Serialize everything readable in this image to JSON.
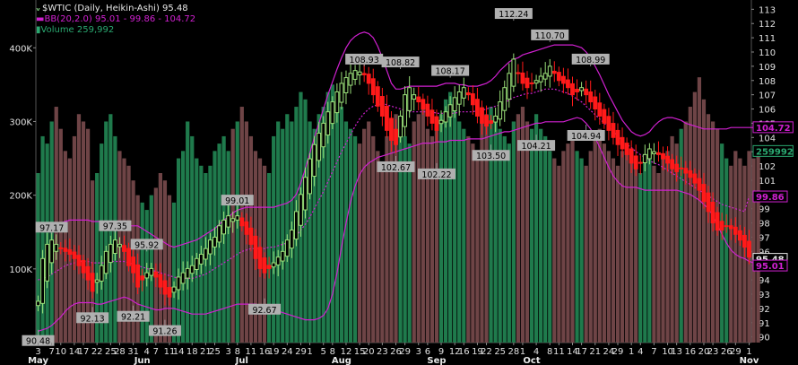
{
  "legend": {
    "title": "$WTIC (Daily, Heikin-Ashi) 95.48",
    "bb": "BB(20,2.0) 95.01 - 99.86 - 104.72",
    "volume": "Volume 259,992"
  },
  "chart_data": {
    "type": "candlestick",
    "title": "$WTIC (Daily, Heikin-Ashi) 95.48",
    "price_axis": {
      "ylim": [
        89.6,
        113.4
      ],
      "ticks": [
        90,
        91,
        92,
        93,
        94,
        95,
        96,
        97,
        98,
        99,
        100,
        101,
        102,
        103,
        104,
        105,
        106,
        107,
        108,
        109,
        110,
        111,
        112,
        113
      ]
    },
    "volume_axis": {
      "ylim": [
        0,
        460000
      ],
      "ticks": [
        "100K",
        "200K",
        "300K",
        "400K"
      ],
      "tick_values": [
        100000,
        200000,
        300000,
        400000
      ]
    },
    "x_tick_labels": [
      "3",
      "7",
      "10",
      "14",
      "17",
      "22",
      "25",
      "28",
      "31",
      "4",
      "7",
      "11",
      "14",
      "18",
      "21",
      "25",
      "3",
      "8",
      "11",
      "16",
      "19",
      "24",
      "29",
      "1",
      "5",
      "8",
      "12",
      "15",
      "20",
      "23",
      "26",
      "29",
      "3",
      "6",
      "9",
      "12",
      "16",
      "19",
      "22",
      "25",
      "28",
      "1",
      "4",
      "8",
      "11",
      "14",
      "17",
      "21",
      "24",
      "29",
      "1",
      "4",
      "7",
      "10",
      "13",
      "16",
      "20",
      "23",
      "26",
      "29",
      "1"
    ],
    "x_month_labels": [
      "May",
      "Jun",
      "Jul",
      "Aug",
      "Sep",
      "Oct",
      "Nov"
    ],
    "month_label_indices": [
      0,
      23,
      45,
      67,
      88,
      109,
      130
    ],
    "price_labels": [
      {
        "text": "97.17",
        "i": 3,
        "price": 97.2
      },
      {
        "text": "97.35",
        "i": 17,
        "price": 97.3
      },
      {
        "text": "95.92",
        "i": 24,
        "price": 96.0
      },
      {
        "text": "99.01",
        "i": 44,
        "price": 99.1
      },
      {
        "text": "108.93",
        "i": 72,
        "price": 109.0
      },
      {
        "text": "108.82",
        "i": 80,
        "price": 108.8
      },
      {
        "text": "108.17",
        "i": 91,
        "price": 108.2
      },
      {
        "text": "112.24",
        "i": 105,
        "price": 112.2
      },
      {
        "text": "110.70",
        "i": 113,
        "price": 110.7
      },
      {
        "text": "108.99",
        "i": 122,
        "price": 109.0
      },
      {
        "text": "90.48",
        "i": 0,
        "price": 90.5
      },
      {
        "text": "92.13",
        "i": 12,
        "price": 92.1
      },
      {
        "text": "92.21",
        "i": 21,
        "price": 92.2
      },
      {
        "text": "91.26",
        "i": 28,
        "price": 91.2
      },
      {
        "text": "92.67",
        "i": 50,
        "price": 92.7
      },
      {
        "text": "102.67",
        "i": 79,
        "price": 102.7
      },
      {
        "text": "102.22",
        "i": 88,
        "price": 102.2
      },
      {
        "text": "103.50",
        "i": 100,
        "price": 103.5
      },
      {
        "text": "104.21",
        "i": 110,
        "price": 104.2
      },
      {
        "text": "104.94",
        "i": 121,
        "price": 104.9
      }
    ],
    "last_labels": [
      {
        "text": "104.72",
        "price": 104.72,
        "color": "#d020d0"
      },
      {
        "text": "99.86",
        "price": 99.86,
        "color": "#d020d0"
      },
      {
        "text": "95.48",
        "price": 95.48,
        "color": "#e8e8e8"
      },
      {
        "text": "95.01",
        "price": 95.01,
        "color": "#d020d0"
      },
      {
        "text": "259992",
        "vol": 259992,
        "color": "#2aa870"
      }
    ],
    "close_path": [
      92.5,
      95.5,
      96.5,
      96.8,
      96.5,
      96.2,
      96.0,
      95.8,
      95.5,
      95.0,
      94.5,
      94.0,
      93.2,
      94.0,
      95.0,
      96.0,
      96.5,
      96.8,
      96.5,
      96.0,
      95.0,
      94.5,
      93.5,
      94.0,
      94.5,
      94.8,
      94.2,
      93.5,
      93.0,
      92.8,
      93.5,
      94.2,
      94.5,
      94.8,
      95.0,
      95.5,
      95.8,
      96.2,
      96.8,
      97.0,
      97.8,
      98.2,
      98.5,
      98.3,
      98.5,
      97.8,
      97.2,
      96.5,
      95.5,
      94.8,
      94.5,
      94.8,
      95.2,
      95.6,
      96.0,
      96.8,
      97.5,
      98.8,
      100.0,
      101.2,
      102.5,
      103.5,
      104.3,
      105.0,
      105.8,
      106.5,
      107.2,
      107.8,
      108.2,
      108.5,
      108.7,
      108.6,
      108.4,
      107.8,
      107.0,
      106.2,
      105.5,
      104.5,
      103.8,
      103.5,
      105.5,
      107.0,
      107.5,
      107.0,
      106.5,
      106.0,
      105.5,
      105.0,
      104.5,
      105.2,
      105.8,
      106.3,
      106.8,
      107.2,
      107.5,
      107.0,
      106.3,
      105.5,
      105.0,
      104.8,
      105.0,
      105.5,
      106.5,
      107.5,
      108.5,
      109.5,
      108.5,
      107.8,
      107.5,
      107.8,
      108.0,
      108.3,
      108.5,
      109.0,
      108.5,
      108.0,
      107.8,
      107.5,
      107.0,
      107.2,
      107.5,
      107.0,
      106.5,
      106.0,
      105.5,
      105.0,
      104.5,
      104.0,
      103.5,
      103.2,
      102.8,
      102.2,
      101.8,
      102.2,
      102.8,
      103.2,
      103.0,
      102.8,
      102.5,
      102.2,
      101.8,
      101.6,
      101.8,
      101.5,
      101.2,
      100.8,
      100.3,
      99.5,
      98.8,
      98.0,
      97.5,
      97.5,
      97.8,
      97.6,
      97.2,
      96.8,
      96.3,
      95.6
    ],
    "volume": [
      230,
      280,
      270,
      300,
      320,
      290,
      260,
      250,
      280,
      310,
      300,
      290,
      220,
      230,
      270,
      300,
      310,
      280,
      260,
      250,
      240,
      220,
      200,
      190,
      180,
      200,
      210,
      230,
      220,
      200,
      190,
      250,
      260,
      300,
      280,
      250,
      240,
      230,
      240,
      260,
      270,
      280,
      260,
      290,
      300,
      320,
      300,
      280,
      260,
      250,
      240,
      230,
      280,
      300,
      290,
      310,
      300,
      320,
      340,
      330,
      300,
      290,
      310,
      320,
      340,
      350,
      330,
      320,
      300,
      290,
      280,
      270,
      290,
      300,
      280,
      260,
      240,
      280,
      300,
      310,
      290,
      280,
      270,
      300,
      310,
      320,
      290,
      280,
      300,
      310,
      330,
      340,
      320,
      300,
      290,
      280,
      270,
      260,
      300,
      310,
      320,
      300,
      290,
      280,
      270,
      300,
      310,
      320,
      300,
      290,
      310,
      290,
      280,
      260,
      250,
      240,
      260,
      270,
      280,
      260,
      250,
      240,
      260,
      280,
      290,
      270,
      260,
      250,
      240,
      260,
      270,
      250,
      240,
      230,
      250,
      260,
      240,
      230,
      250,
      260,
      280,
      270,
      290,
      300,
      320,
      340,
      360,
      330,
      310,
      300,
      290,
      270,
      250,
      240,
      260,
      250,
      240,
      260,
      250,
      260
    ],
    "bb_upper": [
      97.6,
      97.8,
      97.9,
      98.0,
      98.0,
      98.0,
      98.1,
      98.2,
      98.2,
      98.2,
      98.2,
      98.2,
      98.1,
      98.1,
      98.1,
      98.0,
      98.0,
      97.9,
      97.8,
      97.8,
      97.8,
      97.8,
      97.8,
      97.6,
      97.4,
      97.2,
      97.0,
      96.8,
      96.6,
      96.4,
      96.3,
      96.4,
      96.5,
      96.6,
      96.7,
      96.8,
      97.0,
      97.2,
      97.4,
      97.6,
      97.9,
      98.2,
      98.4,
      98.7,
      98.9,
      99.0,
      99.1,
      99.1,
      99.1,
      99.1,
      99.1,
      99.1,
      99.1,
      99.2,
      99.3,
      99.4,
      99.6,
      100.0,
      100.8,
      101.8,
      102.9,
      104.0,
      105.0,
      106.0,
      107.0,
      107.9,
      108.8,
      109.6,
      110.3,
      110.8,
      111.1,
      111.3,
      111.4,
      111.3,
      111.0,
      110.4,
      109.6,
      108.7,
      107.8,
      107.4,
      107.4,
      107.5,
      107.6,
      107.6,
      107.6,
      107.6,
      107.6,
      107.6,
      107.6,
      107.7,
      107.8,
      107.8,
      107.8,
      107.7,
      107.7,
      107.6,
      107.6,
      107.6,
      107.7,
      107.8,
      108.0,
      108.3,
      108.7,
      109.0,
      109.3,
      109.5,
      109.6,
      109.8,
      109.9,
      110.0,
      110.1,
      110.2,
      110.3,
      110.4,
      110.5,
      110.5,
      110.5,
      110.5,
      110.5,
      110.4,
      110.3,
      110.0,
      109.6,
      109.0,
      108.4,
      107.7,
      107.0,
      106.4,
      105.8,
      105.2,
      104.8,
      104.4,
      104.2,
      104.1,
      104.2,
      104.4,
      104.8,
      105.1,
      105.3,
      105.4,
      105.4,
      105.3,
      105.2,
      105.0,
      104.9,
      104.8,
      104.7,
      104.6,
      104.6,
      104.6,
      104.6,
      104.6,
      104.6,
      104.7,
      104.7,
      104.7,
      104.7,
      104.7,
      104.7,
      104.72
    ],
    "bb_mid": [
      94.0,
      94.1,
      94.2,
      94.4,
      94.6,
      94.8,
      95.0,
      95.1,
      95.2,
      95.3,
      95.3,
      95.3,
      95.2,
      95.2,
      95.2,
      95.2,
      95.3,
      95.3,
      95.3,
      95.3,
      95.2,
      95.1,
      95.0,
      94.9,
      94.8,
      94.7,
      94.6,
      94.5,
      94.4,
      94.3,
      94.2,
      94.1,
      94.1,
      94.1,
      94.1,
      94.2,
      94.3,
      94.4,
      94.6,
      94.8,
      95.0,
      95.2,
      95.4,
      95.6,
      95.8,
      96.0,
      96.1,
      96.2,
      96.2,
      96.2,
      96.2,
      96.3,
      96.3,
      96.4,
      96.5,
      96.6,
      96.8,
      97.1,
      97.5,
      97.9,
      98.4,
      99.0,
      99.6,
      100.2,
      100.9,
      101.6,
      102.3,
      103.0,
      103.6,
      104.2,
      104.8,
      105.3,
      105.7,
      106.0,
      106.2,
      106.3,
      106.4,
      106.3,
      106.2,
      106.1,
      106.0,
      105.9,
      105.8,
      105.8,
      105.8,
      105.8,
      105.8,
      105.8,
      105.7,
      105.7,
      105.7,
      105.7,
      105.7,
      105.8,
      105.8,
      105.8,
      105.8,
      105.9,
      105.9,
      106.0,
      106.1,
      106.2,
      106.3,
      106.5,
      106.6,
      106.8,
      106.9,
      107.0,
      107.1,
      107.1,
      107.2,
      107.3,
      107.4,
      107.4,
      107.4,
      107.3,
      107.2,
      107.1,
      106.9,
      106.7,
      106.5,
      106.2,
      105.9,
      105.6,
      105.3,
      105.0,
      104.7,
      104.4,
      104.1,
      103.8,
      103.5,
      103.3,
      103.0,
      102.8,
      102.6,
      102.4,
      102.2,
      102.1,
      101.9,
      101.7,
      101.5,
      101.3,
      101.1,
      100.9,
      100.7,
      100.5,
      100.3,
      100.1,
      99.9,
      99.7,
      99.5,
      99.3,
      99.2,
      99.1,
      99.0,
      98.9,
      98.8,
      99.86
    ],
    "bb_lower": [
      90.4,
      90.5,
      90.6,
      90.8,
      91.1,
      91.4,
      91.8,
      92.1,
      92.3,
      92.4,
      92.4,
      92.4,
      92.4,
      92.3,
      92.3,
      92.4,
      92.5,
      92.6,
      92.7,
      92.8,
      92.7,
      92.5,
      92.3,
      92.2,
      92.1,
      92.0,
      91.9,
      91.9,
      92.0,
      92.0,
      92.0,
      91.9,
      91.8,
      91.7,
      91.6,
      91.6,
      91.6,
      91.6,
      91.7,
      91.8,
      91.9,
      92.0,
      92.1,
      92.2,
      92.3,
      92.3,
      92.3,
      92.3,
      92.3,
      92.2,
      92.1,
      92.0,
      91.9,
      91.8,
      91.7,
      91.6,
      91.5,
      91.4,
      91.3,
      91.2,
      91.2,
      91.2,
      91.3,
      91.5,
      92.0,
      93.0,
      94.5,
      96.3,
      98.0,
      99.5,
      100.6,
      101.4,
      101.9,
      102.2,
      102.4,
      102.6,
      102.7,
      102.8,
      102.9,
      103.0,
      103.1,
      103.2,
      103.3,
      103.4,
      103.5,
      103.6,
      103.6,
      103.6,
      103.7,
      103.7,
      103.7,
      103.8,
      103.8,
      103.8,
      103.8,
      103.9,
      103.9,
      103.9,
      103.9,
      104.0,
      104.1,
      104.2,
      104.3,
      104.4,
      104.4,
      104.5,
      104.6,
      104.7,
      104.8,
      104.9,
      105.0,
      105.0,
      105.1,
      105.1,
      105.1,
      105.1,
      105.1,
      105.2,
      105.3,
      105.4,
      105.3,
      105.0,
      104.6,
      104.0,
      103.3,
      102.6,
      101.9,
      101.3,
      100.9,
      100.6,
      100.5,
      100.5,
      100.5,
      100.4,
      100.3,
      100.3,
      100.3,
      100.3,
      100.3,
      100.3,
      100.3,
      100.3,
      100.2,
      100.1,
      100.0,
      99.8,
      99.6,
      99.3,
      99.0,
      98.5,
      97.9,
      97.2,
      96.6,
      96.1,
      95.8,
      95.6,
      95.5,
      95.3,
      95.2,
      95.1,
      95.01
    ]
  }
}
